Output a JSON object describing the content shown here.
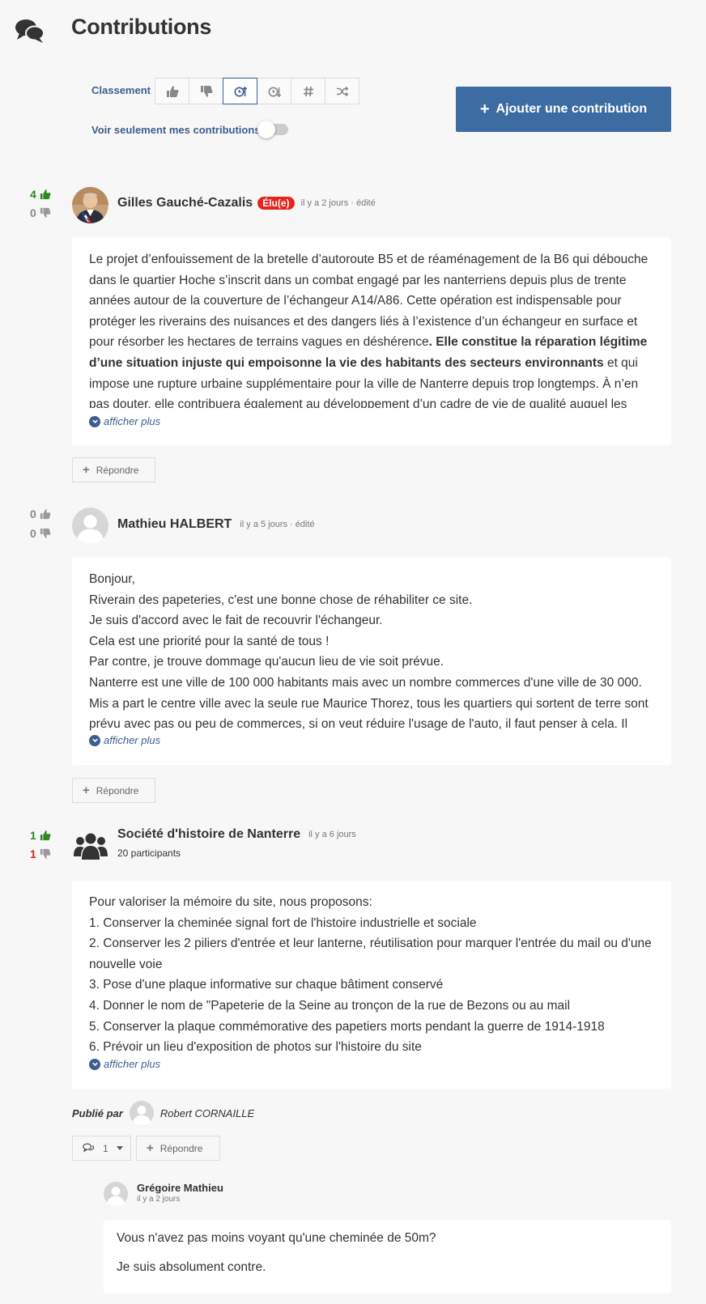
{
  "header": {
    "title": "Contributions",
    "icon": "comments-icon"
  },
  "sort": {
    "label": "Classement",
    "buttons": [
      {
        "icon": "thumbs-up-icon",
        "active": false
      },
      {
        "icon": "thumbs-down-icon",
        "active": false
      },
      {
        "icon": "clock-arrow-up-icon",
        "active": true
      },
      {
        "icon": "clock-arrow-down-icon",
        "active": false
      },
      {
        "icon": "hash-icon",
        "active": false
      },
      {
        "icon": "shuffle-icon",
        "active": false
      }
    ]
  },
  "filter": {
    "mine_label": "Voir seulement mes contributions",
    "mine_on": false
  },
  "add_button": {
    "label": "Ajouter une contribution"
  },
  "reply_label": "Répondre",
  "more_label": "afficher plus",
  "contributions": [
    {
      "up": "4",
      "down": "0",
      "author": "Gilles Gauché-Cazalis",
      "badge": "Élu(e)",
      "meta": "il y a 2 jours · édité",
      "text_a": "Le projet d’enfouissement de la bretelle d’autoroute B5 et de réaménagement de la B6 qui débouche dans le quartier Hoche s’inscrit dans un combat engagé par les nanterriens depuis plus de trente années autour de la couverture de l’échangeur A14/A86. Cette opération est indispensable pour protéger les riverains des nuisances et des dangers liés à l’existence d’un échangeur en surface et pour résorber les hectares de terrains vagues en déshérence",
      "text_b": ". Elle constitue la réparation légitime d’une situation injuste qui empoisonne la vie des habitants des secteurs environnants",
      "text_c": " et qui impose une rupture urbaine supplémentaire pour la ville de Nanterre depuis trop longtemps. À n’en pas douter, elle contribuera également au développement d’un cadre de vie de qualité auquel les"
    },
    {
      "up": "0",
      "down": "0",
      "author": "Mathieu HALBERT",
      "meta": "il y a 5 jours · édité",
      "lines": [
        "Bonjour,",
        "Riverain des papeteries, c'est une bonne chose de réhabiliter ce site.",
        "Je suis d'accord avec le fait de recouvrir l'échangeur.",
        "Cela est une priorité pour la santé de tous !",
        "Par contre, je trouve dommage qu'aucun lieu de vie soit prévue.",
        "Nanterre est une ville de 100 000 habitants mais avec un nombre commerces d'une ville de 30 000.",
        "Mis a part le centre ville avec la seule rue Maurice Thorez, tous les quartiers qui sortent de terre sont prévu avec pas ou peu de commerces, si on veut réduire l'usage de l'auto, il faut penser à cela. Il"
      ]
    },
    {
      "up": "1",
      "down": "1",
      "author": "Société d'histoire de Nanterre",
      "meta": "il y a 6 jours",
      "participants": "20 participants",
      "lines": [
        "Pour valoriser la mémoire du site, nous proposons:",
        "1. Conserver la cheminée signal fort de l'histoire industrielle et sociale",
        "2. Conserver les 2 piliers d'entrée et leur lanterne, réutilisation pour marquer l'entrée du mail ou d'une nouvelle voie",
        "3. Pose d'une plaque informative sur chaque bâtiment conservé",
        "4.  Donner le nom de \"Papeterie de la Seine au tronçon de la rue de Bezons ou au mail",
        "5. Conserver la plaque commémorative des papetiers morts pendant la guerre de 1914-1918",
        "6. Prévoir un lieu d'exposition de photos sur l'histoire du site"
      ],
      "published_by_label": "Publié par",
      "published_by": "Robert CORNAILLE",
      "replies_count": "1",
      "reply": {
        "author": "Grégoire Mathieu",
        "meta": "il y a 2 jours",
        "lines": [
          "Vous n'avez pas moins voyant qu'une cheminée de 50m?",
          "Je suis absolument contre."
        ]
      }
    }
  ]
}
